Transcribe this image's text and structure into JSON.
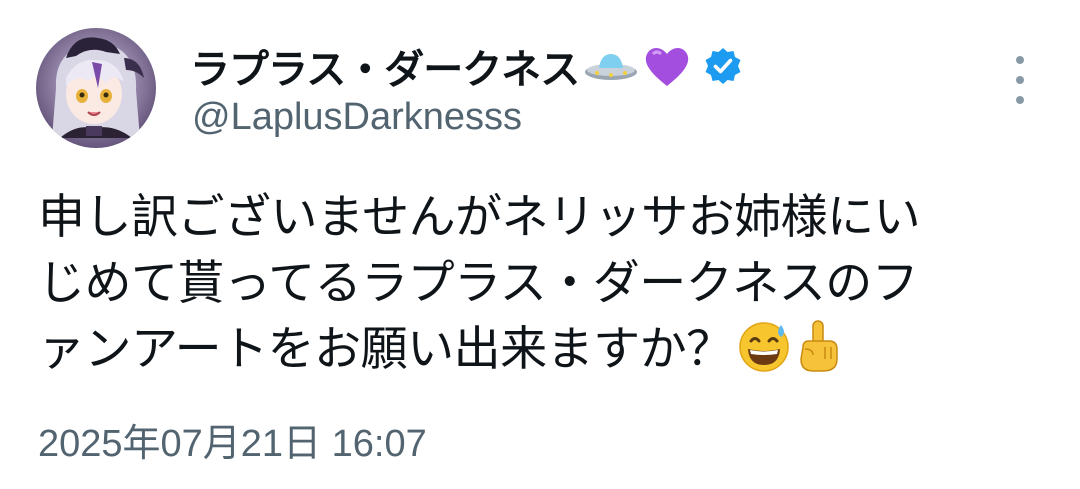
{
  "author": {
    "display_name": "ラプラス・ダークネス",
    "name_emojis": [
      "ufo-emoji",
      "purple-heart-emoji"
    ],
    "verified": true,
    "handle": "@LaplusDarknesss"
  },
  "tweet": {
    "lines": [
      "申し訳ございませんがネリッサお姉様にい",
      "じめて貰ってるラプラス・ダークネスのフ",
      "ァンアートをお願い出来ますか？"
    ],
    "trailing_emojis": [
      "grinning-sweat-emoji",
      "pointing-up-emoji"
    ],
    "timestamp": "2025年07月21日 16:07"
  },
  "colors": {
    "text_primary": "#0f1419",
    "text_secondary": "#536471",
    "verified_blue": "#1d9bf0",
    "more_dots": "#8899a6"
  },
  "icons": {
    "more": "more-vertical-icon",
    "verified": "verified-badge-icon"
  }
}
